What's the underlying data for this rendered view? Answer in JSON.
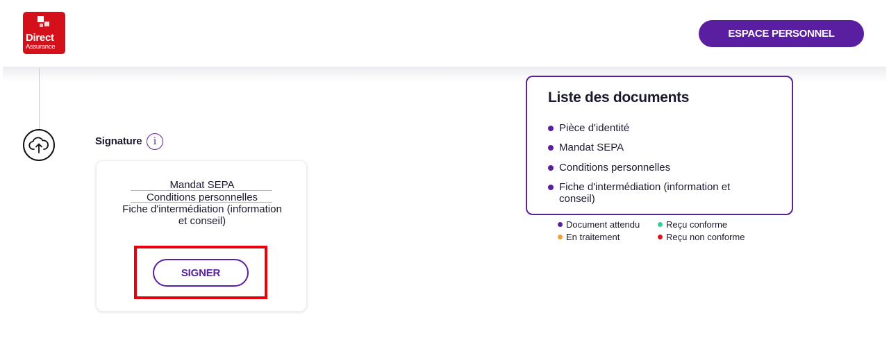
{
  "header": {
    "logo": {
      "line1": "Direct",
      "line2": "Assurance",
      "color": "#d4111a"
    },
    "espace_button": "ESPACE PERSONNEL"
  },
  "timeline": {
    "icon": "cloud-upload-icon"
  },
  "signature": {
    "title": "Signature",
    "info_icon": "i",
    "documents": [
      "Mandat SEPA",
      "Conditions personnelles",
      "Fiche d'intermédiation (information",
      "et conseil)"
    ],
    "sign_button": "SIGNER"
  },
  "documents_panel": {
    "title": "Liste des documents",
    "items": [
      {
        "line1": "Pièce d'identité",
        "line2": ""
      },
      {
        "line1": "Mandat SEPA",
        "line2": ""
      },
      {
        "line1": "Conditions personnelles",
        "line2": ""
      },
      {
        "line1": "Fiche d'intermédiation (information et",
        "line2": "conseil)"
      }
    ]
  },
  "legend": [
    {
      "label": "Document attendu",
      "color": "#5a1fa0"
    },
    {
      "label": "Reçu conforme",
      "color": "#2fd39a"
    },
    {
      "label": "En traitement",
      "color": "#f0a030"
    },
    {
      "label": "Reçu non conforme",
      "color": "#e0141e"
    }
  ],
  "colors": {
    "primary": "#5a1fa0",
    "highlight_frame": "#e8000b"
  }
}
